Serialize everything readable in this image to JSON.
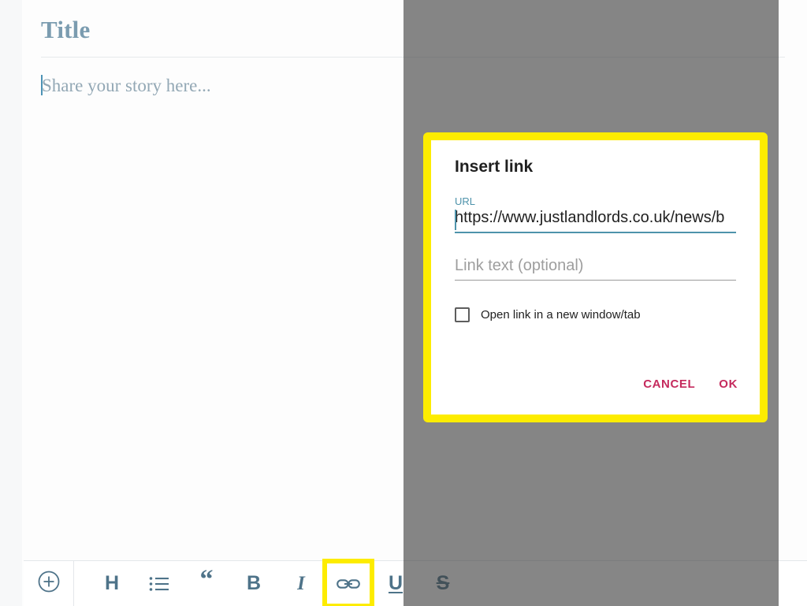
{
  "editor": {
    "title_placeholder": "Title",
    "body_placeholder": "Share your story here...",
    "caret_visible": true
  },
  "toolbar": {
    "add_button": {
      "label": "+",
      "icon": "plus-circle-icon"
    },
    "items": [
      {
        "id": "heading",
        "label": "H",
        "icon": "heading-icon"
      },
      {
        "id": "list",
        "label": "",
        "icon": "bulleted-list-icon"
      },
      {
        "id": "quote",
        "label": "“",
        "icon": "blockquote-icon"
      },
      {
        "id": "bold",
        "label": "B",
        "icon": "bold-icon"
      },
      {
        "id": "italic",
        "label": "I",
        "icon": "italic-icon"
      },
      {
        "id": "link",
        "label": "",
        "icon": "link-icon",
        "highlighted": true
      },
      {
        "id": "underline",
        "label": "U",
        "icon": "underline-icon"
      },
      {
        "id": "strikethrough",
        "label": "S",
        "icon": "strikethrough-icon"
      }
    ]
  },
  "dialog": {
    "title": "Insert link",
    "url_label": "URL",
    "url_value": "https://www.justlandlords.co.uk/news/b",
    "link_text_placeholder": "Link text (optional)",
    "link_text_value": "",
    "checkbox_label": "Open link in a new window/tab",
    "checkbox_checked": false,
    "cancel_label": "CANCEL",
    "ok_label": "OK"
  },
  "colors": {
    "highlight": "#fdec00",
    "accent_teal": "#4e93ab",
    "accent_crimson": "#c52a5d",
    "toolbar_icon": "#4e7389",
    "title_text": "#7b9cb0",
    "overlay_gray": "#666666"
  }
}
